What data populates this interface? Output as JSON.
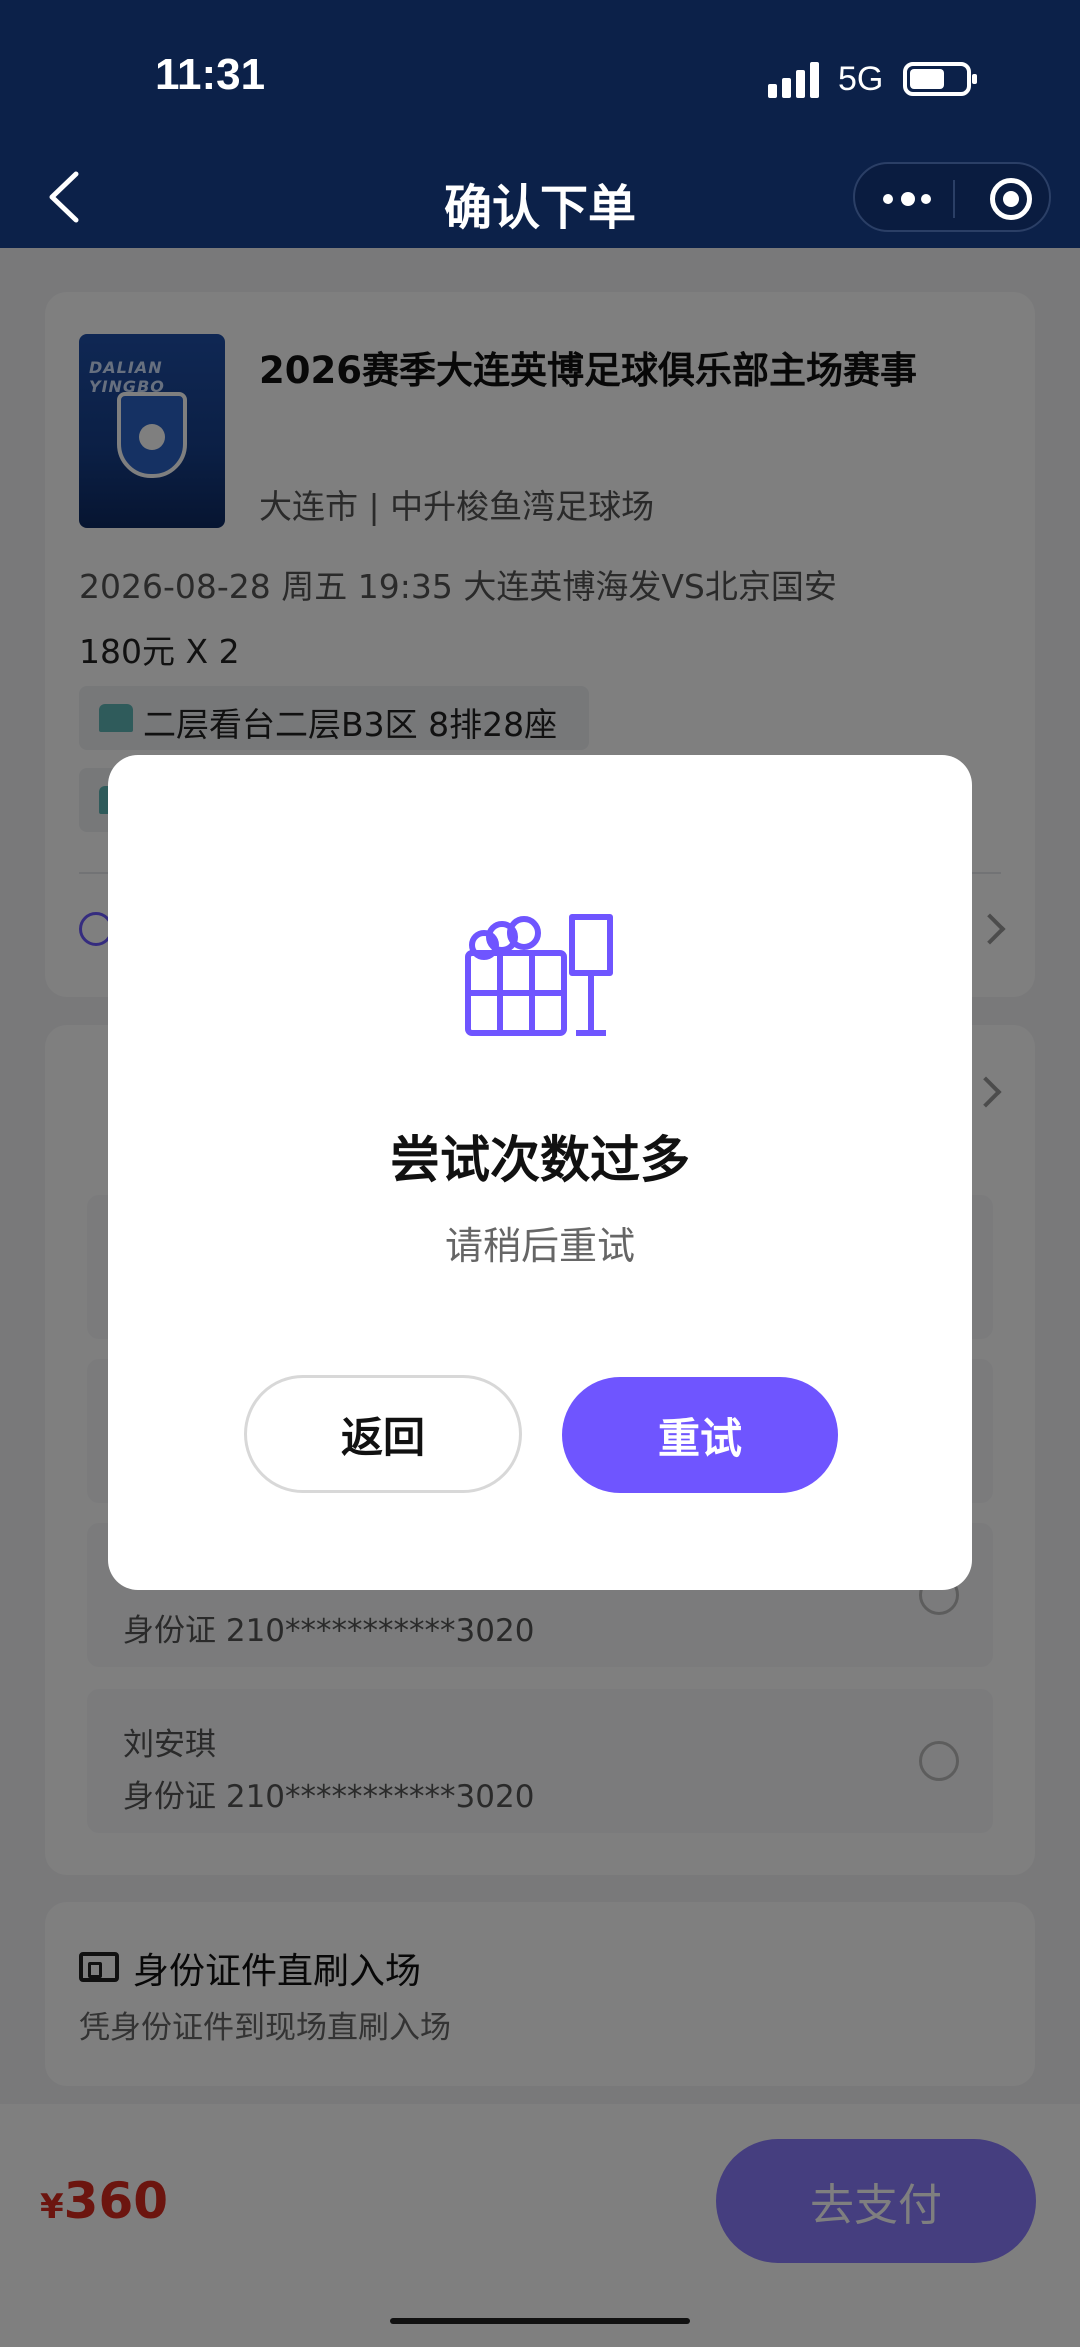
{
  "status_bar": {
    "time": "11:31",
    "network": "5G"
  },
  "nav": {
    "title": "确认下单"
  },
  "event": {
    "poster_text": "DALIAN YINGBO",
    "title": "2026赛季大连英博足球俱乐部主场赛事",
    "venue": "大连市 | 中升梭鱼湾足球场",
    "datetime": "2026-08-28 周五 19:35 大连英博海发VS北京国安",
    "price_qty": "180元 X 2",
    "seat": "二层看台二层B3区 8排28座"
  },
  "persons": [
    {
      "name": "",
      "id": "身份证  210***********3020"
    },
    {
      "name": "刘安琪",
      "id": "身份证  210***********3020"
    }
  ],
  "entry": {
    "title": "身份证件直刷入场",
    "subtitle": "凭身份证件到现场直刷入场"
  },
  "bottom": {
    "currency": "¥",
    "total": "360",
    "pay_label": "去支付"
  },
  "modal": {
    "title": "尝试次数过多",
    "subtitle": "请稍后重试",
    "back_label": "返回",
    "retry_label": "重试",
    "accent": "#6f55ff"
  }
}
